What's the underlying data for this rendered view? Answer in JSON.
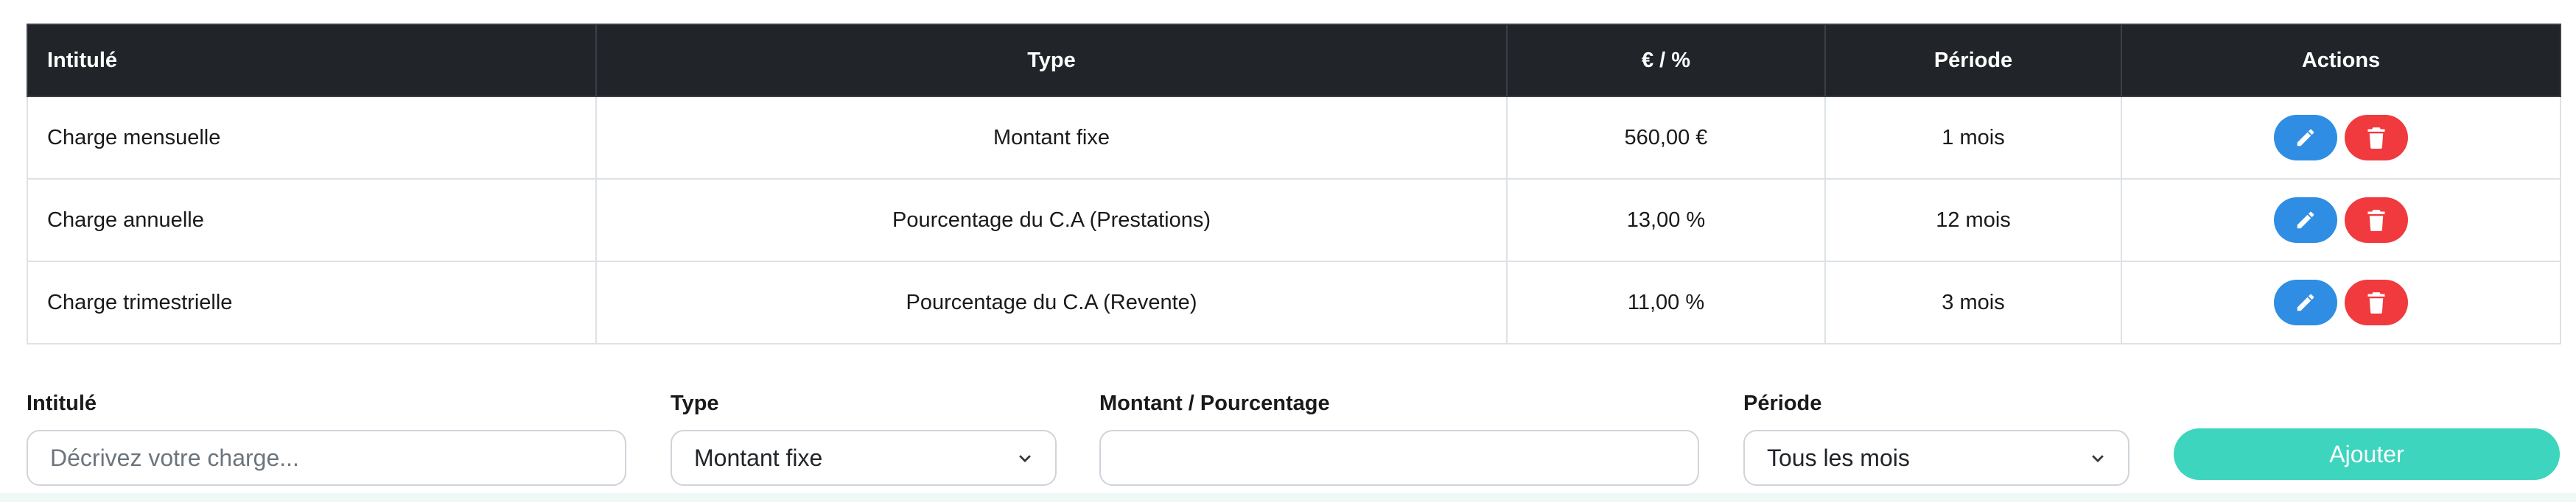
{
  "table": {
    "headers": [
      "Intitulé",
      "Type",
      "€ / %",
      "Période",
      "Actions"
    ],
    "rows": [
      {
        "label": "Charge mensuelle",
        "type": "Montant fixe",
        "value": "560,00 €",
        "period": "1 mois"
      },
      {
        "label": "Charge annuelle",
        "type": "Pourcentage du C.A (Prestations)",
        "value": "13,00 %",
        "period": "12 mois"
      },
      {
        "label": "Charge trimestrielle",
        "type": "Pourcentage du C.A (Revente)",
        "value": "11,00 %",
        "period": "3 mois"
      }
    ],
    "icons": {
      "edit": "pencil-icon",
      "delete": "trash-icon"
    }
  },
  "form": {
    "label_field": {
      "label": "Intitulé",
      "placeholder": "Décrivez votre charge...",
      "value": ""
    },
    "type_field": {
      "label": "Type",
      "selected": "Montant fixe"
    },
    "amount_field": {
      "label": "Montant / Pourcentage",
      "value": ""
    },
    "period_field": {
      "label": "Période",
      "selected": "Tous les mois"
    },
    "add_button": "Ajouter"
  },
  "colors": {
    "header_bg": "#212529",
    "edit": "#2f8de4",
    "delete": "#f03a3e",
    "add": "#3dd5be"
  }
}
